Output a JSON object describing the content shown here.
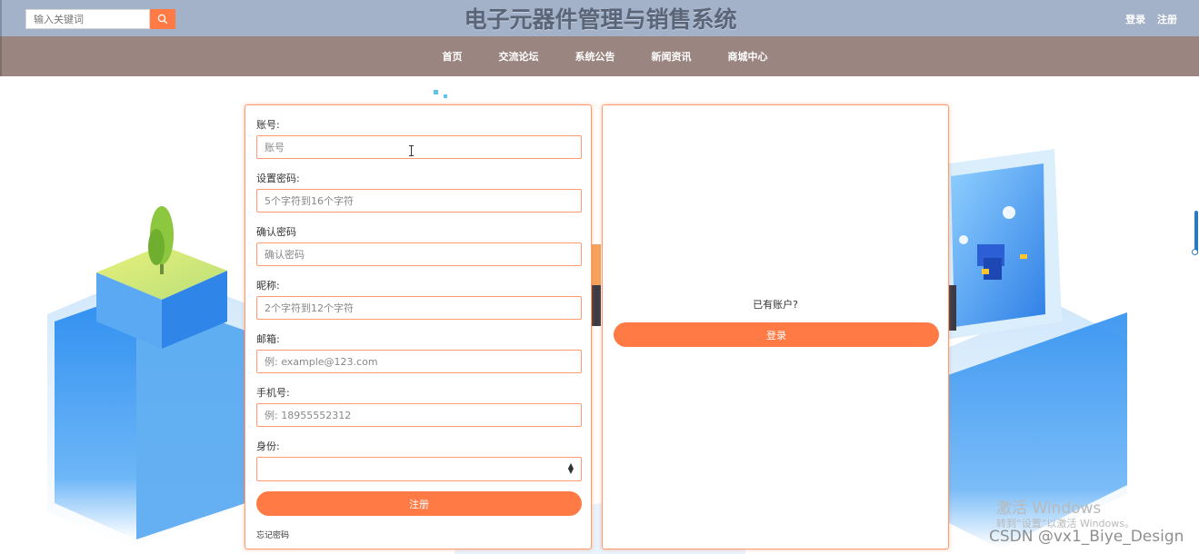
{
  "header": {
    "search_placeholder": "输入关键词",
    "title": "电子元器件管理与销售系统",
    "login_link": "登录",
    "register_link": "注册"
  },
  "nav": {
    "items": [
      "首页",
      "交流论坛",
      "系统公告",
      "新闻资讯",
      "商城中心"
    ]
  },
  "register_form": {
    "fields": [
      {
        "label": "账号:",
        "placeholder": "账号"
      },
      {
        "label": "设置密码:",
        "placeholder": "5个字符到16个字符"
      },
      {
        "label": "确认密码",
        "placeholder": "确认密码"
      },
      {
        "label": "昵称:",
        "placeholder": "2个字符到12个字符"
      },
      {
        "label": "邮箱:",
        "placeholder": "例: example@123.com"
      },
      {
        "label": "手机号:",
        "placeholder": "例: 18955552312"
      }
    ],
    "role_label": "身份:",
    "role_value": "",
    "submit_label": "注册",
    "forgot_label": "忘记密码"
  },
  "login_panel": {
    "prompt": "已有账户?",
    "login_button": "登录"
  },
  "watermarks": {
    "windows_line1": "激活 Windows",
    "windows_line2": "转到“设置”以激活 Windows。",
    "csdn": "CSDN @vx1_Biye_Design"
  },
  "colors": {
    "accent": "#ff7a45",
    "header_bg": "#a3b2c9",
    "nav_bg": "#9a8580",
    "title_color": "#5b6579"
  }
}
